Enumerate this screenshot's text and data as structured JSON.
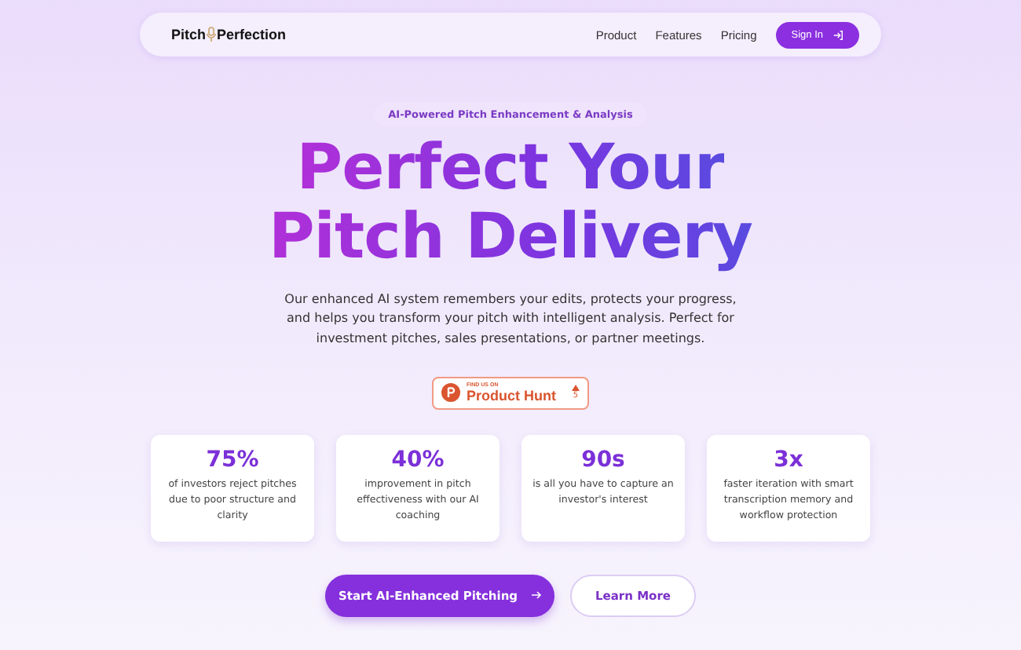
{
  "nav": {
    "logo_left": "Pitch",
    "logo_right": "Perfection",
    "links": [
      "Product",
      "Features",
      "Pricing"
    ],
    "sign_in": "Sign In"
  },
  "hero": {
    "badge": "AI-Powered Pitch Enhancement & Analysis",
    "title_lines": [
      "Perfect Your",
      "Pitch Delivery"
    ],
    "description": "Our enhanced AI system remembers your edits, protects your progress, and helps you transform your pitch with intelligent analysis. Perfect for investment pitches, sales presentations, or partner meetings."
  },
  "product_hunt": {
    "caption": "FIND US ON",
    "name": "Product Hunt",
    "votes": "5"
  },
  "stats": [
    {
      "value": "75%",
      "text": "of investors reject pitches due to poor structure and clarity"
    },
    {
      "value": "40%",
      "text": "improvement in pitch effectiveness with our AI coaching"
    },
    {
      "value": "90s",
      "text": "is all you have to capture an investor's interest"
    },
    {
      "value": "3x",
      "text": "faster iteration with smart transcription memory and workflow protection"
    }
  ],
  "actions": {
    "primary": "Start AI-Enhanced Pitching",
    "secondary": "Learn More"
  }
}
